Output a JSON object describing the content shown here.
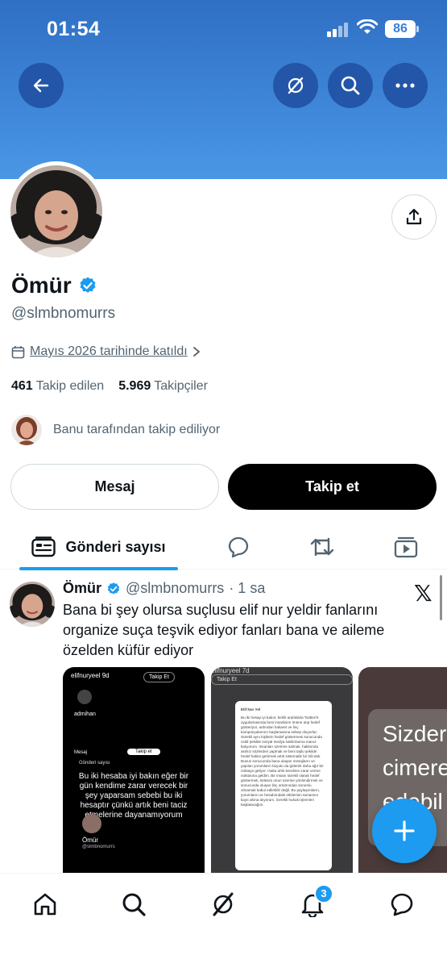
{
  "status_bar": {
    "time": "01:54",
    "battery": "86"
  },
  "profile": {
    "name": "Ömür",
    "handle": "@slmbnomurrs",
    "joined": "Mayıs 2026 tarihinde katıldı",
    "following_count": "461",
    "following_label": "Takip edilen",
    "followers_count": "5.969",
    "followers_label": "Takipçiler",
    "followed_by": "Banu tarafından takip ediliyor"
  },
  "actions": {
    "message": "Mesaj",
    "follow": "Takip et"
  },
  "tabs": {
    "active": "Gönderi sayısı"
  },
  "post": {
    "name": "Ömür",
    "handle": "@slmbnomurrs",
    "time": "· 1 sa",
    "text": "Bana bi şey olursa suçlusu elif nur yeldir fanlarını organize suça teşvik ediyor fanları bana ve aileme özelden küfür ediyor",
    "media": [
      {
        "account": "elifnuryeel",
        "age": "9d",
        "follow": "Takip Et",
        "inner_name": "admihan",
        "inner_tab": "Gönderi sayısı",
        "inner_msg": "Mesaj",
        "inner_follow": "Takip et",
        "caption": "Bu iki hesaba iyi bakın eğer bir gün kendime zarar verecek bir şey yaparsam sebebi bu iki hesaptır çünkü artık beni taciz etmelerine dayanamıyorum",
        "footer_name": "Ömür",
        "footer_handle": "@slmbnomurrs"
      },
      {
        "account": "elifnuryeel",
        "age": "7d",
        "follow": "Takip Et",
        "doc_title": "Elif Nur Yel",
        "doc_text": "Bu iki hesap iyi bakın; belirli aralıklarla Twitter/X uygulamasında beni insanların önüne atıp hedef gösteriyor, ardından hakaret ve linç kampanyalarının başlamasına sebep oluyorlar. Sürekli aynı kişilerin hedef göstermesi sonucunda ciddi şekilde sosyal medya saldırılarına maruz kalıyorum. İnsanları üzerime salmak, hakkımda asılsız sözlerden yapmak ve beni taşlu şekilde hedef haline getirmek artık sistematik bir hâl aldı. Bunun sonucunda bana ulaşan mesajların ve yapılan yorumların boyutu da giderek daha ağır bir noktaya geliyor. Hatta artık kendime zarar verme noktasına geldim. Bir insanı sürekli olarak hedef göstermek, kitlesini onun üzerine yönlendirmek ve sonucunda oluşan linç ortamından sorumlu olmamak kabul edilebilir değil. Bu paylaşımların, yorumların ve hesabımdaki etkilerinin tamamını kayıt altına alıyorum. Gerekli hukuki işlemleri başlatacağım."
      },
      {
        "lines": [
          "Sizder",
          "cimere",
          "edebil"
        ]
      }
    ]
  },
  "nav": {
    "notifications_badge": "3"
  },
  "colors": {
    "accent": "#1d9bf0",
    "banner": "#3d86dc",
    "text": "#0f1419",
    "muted": "#536471"
  },
  "icons": [
    "back-arrow-icon",
    "grok-icon",
    "search-icon",
    "more-icon",
    "share-icon",
    "verified-badge-icon",
    "calendar-icon",
    "chevron-right-icon",
    "posts-icon",
    "reply-icon",
    "repost-icon",
    "video-icon",
    "x-logo-icon",
    "plus-icon",
    "home-icon",
    "bell-icon",
    "messages-icon"
  ]
}
